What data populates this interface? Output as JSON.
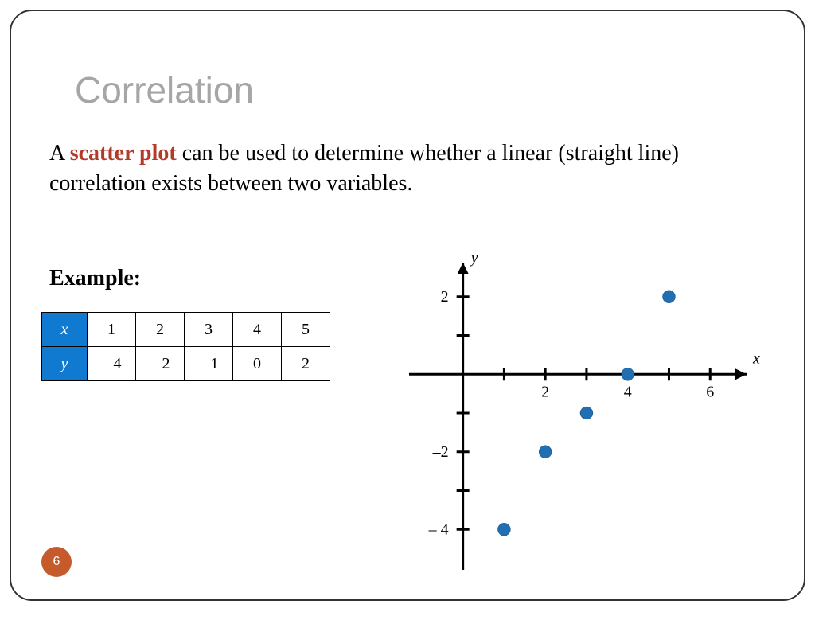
{
  "title": "Correlation",
  "body": {
    "pre": "A ",
    "keyword": "scatter plot",
    "post": " can be used to determine whether a linear (straight line) correlation exists between two variables."
  },
  "example_label": "Example:",
  "table": {
    "x_header": "x",
    "y_header": "y",
    "x": [
      "1",
      "2",
      "3",
      "4",
      "5"
    ],
    "y": [
      "– 4",
      "– 2",
      "– 1",
      "0",
      "2"
    ]
  },
  "chart_data": {
    "type": "scatter",
    "points": [
      {
        "x": 1,
        "y": -4
      },
      {
        "x": 2,
        "y": -2
      },
      {
        "x": 3,
        "y": -1
      },
      {
        "x": 4,
        "y": 0
      },
      {
        "x": 5,
        "y": 2
      }
    ],
    "xlabel": "x",
    "ylabel": "y",
    "x_ticks": [
      1,
      2,
      3,
      4,
      5,
      6
    ],
    "y_ticks": [
      -4,
      -3,
      -2,
      -1,
      1,
      2
    ],
    "x_tick_labels": {
      "2": "2",
      "4": "4",
      "6": "6"
    },
    "y_tick_labels": {
      "2": "2",
      "-2": "–2",
      "-4": "– 4"
    },
    "xlim": [
      -1.5,
      7
    ],
    "ylim": [
      -5,
      3
    ]
  },
  "page_number": "6"
}
